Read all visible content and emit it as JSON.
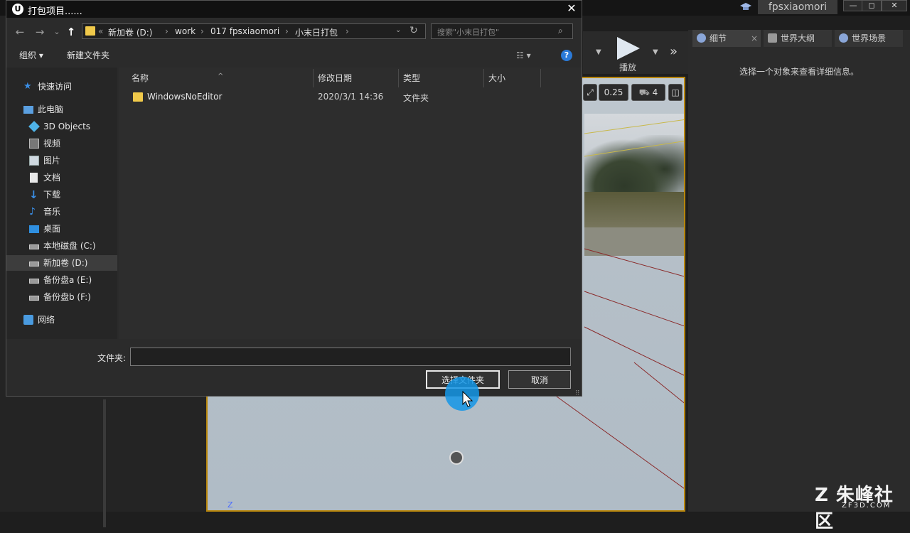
{
  "editor": {
    "project_name": "fpsxiaomori",
    "window_buttons": [
      "—",
      "◻",
      "✕"
    ],
    "toolbar": {
      "play_label": "播放",
      "more": "»"
    },
    "viewport": {
      "fov_value": "0.25",
      "camera_speed": "4"
    },
    "right_tabs": [
      "细节",
      "世界大纲",
      "世界场景"
    ],
    "details_hint": "选择一个对象来查看详细信息。",
    "axis_label": "Z"
  },
  "dialog": {
    "title": "打包项目......",
    "title_icon": "U",
    "close": "✕",
    "nav": {
      "back": "←",
      "forward": "→",
      "recent": "⌄",
      "up": "↑"
    },
    "address": {
      "lead": "«",
      "segments": [
        "新加卷 (D:)",
        "work",
        "017 fpsxiaomori",
        "小末日打包"
      ],
      "separator": "›",
      "dropdown": "⌄",
      "refresh": "↻"
    },
    "search": {
      "placeholder": "搜索\"小末日打包\"",
      "icon": "⌕"
    },
    "commands": {
      "organize": "组织 ▾",
      "new_folder": "新建文件夹",
      "view": "☷ ▾",
      "help": "?"
    },
    "nav_pane": [
      {
        "label": "快速访问",
        "icon": "star-icon"
      },
      {
        "label": "此电脑",
        "icon": "computer-icon"
      },
      {
        "label": "3D Objects",
        "icon": "cube-icon"
      },
      {
        "label": "视频",
        "icon": "video-icon"
      },
      {
        "label": "图片",
        "icon": "picture-icon"
      },
      {
        "label": "文档",
        "icon": "document-icon"
      },
      {
        "label": "下载",
        "icon": "download-icon"
      },
      {
        "label": "音乐",
        "icon": "music-icon"
      },
      {
        "label": "桌面",
        "icon": "desktop-icon"
      },
      {
        "label": "本地磁盘 (C:)",
        "icon": "drive-icon"
      },
      {
        "label": "新加卷 (D:)",
        "icon": "drive-icon",
        "selected": true
      },
      {
        "label": "备份盘a (E:)",
        "icon": "drive-icon"
      },
      {
        "label": "备份盘b (F:)",
        "icon": "drive-icon"
      },
      {
        "label": "网络",
        "icon": "network-icon"
      }
    ],
    "columns": [
      "名称",
      "修改日期",
      "类型",
      "大小"
    ],
    "sort_indicator": "^",
    "files": [
      {
        "name": "WindowsNoEditor",
        "modified": "2020/3/1 14:36",
        "type": "文件夹",
        "size": ""
      }
    ],
    "folder_label": "文件夹:",
    "folder_value": "",
    "buttons": {
      "select_folder": "选择文件夹",
      "cancel": "取消"
    },
    "resize_grip": "⠿"
  },
  "watermark": {
    "big": "Z 朱峰社区",
    "small": "ZF3D.COM"
  },
  "colors": {
    "accent_folder": "#f0c94a",
    "cursor_halo": "#1496e6",
    "viewport_border": "#b8860b",
    "help_blue": "#2b7ad8"
  }
}
